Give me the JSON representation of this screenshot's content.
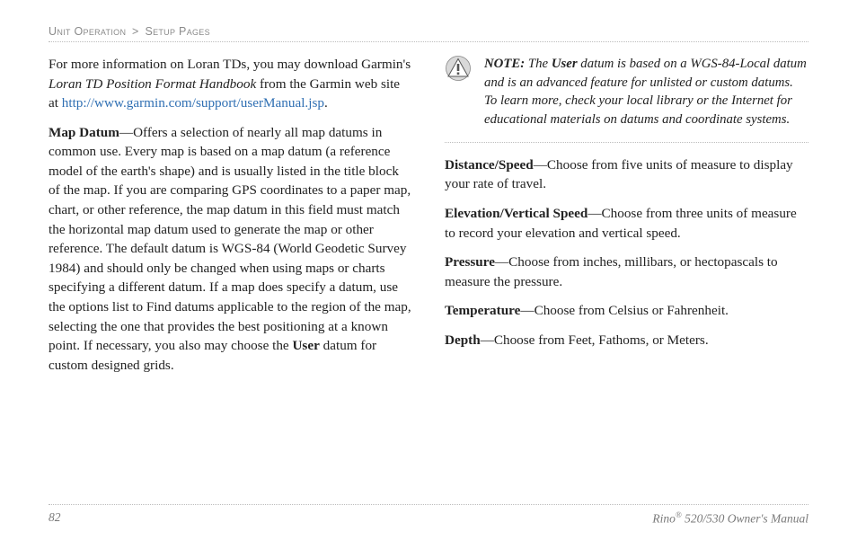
{
  "breadcrumb": {
    "section": "Unit Operation",
    "sep": ">",
    "subsection": "Setup Pages"
  },
  "left": {
    "intro": {
      "pre": "For more information on Loran TDs, you may download Garmin's ",
      "em": "Loran TD Position Format Handbook",
      "mid": " from the Garmin web site at ",
      "link": "http://www.garmin.com/support/userManual.jsp",
      "post": "."
    },
    "mapDatum": {
      "label": "Map Datum",
      "body1": "—Offers a selection of nearly all map datums in common use. Every map is based on a map datum (a reference model of the earth's shape) and is usually listed in the title block of the map. If you are comparing GPS coordinates to a paper map, chart, or other reference, the map datum in this field must match the horizontal map datum used to generate the map or other reference. The default datum is WGS-84 (World Geodetic Survey 1984) and should only be changed when using maps or charts specifying a different datum. If a map does specify a datum, use the options list to Find datums applicable to the region of the map, selecting the one that provides the best positioning at a known point. If necessary, you also may choose the ",
      "userWord": "User",
      "body2": " datum for custom designed grids."
    }
  },
  "right": {
    "note": {
      "label": "NOTE:",
      "pre": " The ",
      "userWord": "User",
      "body": " datum is based on a WGS-84-Local datum and is an advanced feature for unlisted or custom datums. To learn more, check your local library or the Internet for educational materials on datums and coordinate systems."
    },
    "items": {
      "distance": {
        "label": "Distance/Speed",
        "body": "—Choose from five units of measure to display your rate of travel."
      },
      "elevation": {
        "label": "Elevation/Vertical Speed",
        "body": "—Choose from three units of measure to record your elevation and vertical speed."
      },
      "pressure": {
        "label": "Pressure",
        "body": "—Choose from inches, millibars, or hectopascals to measure the pressure."
      },
      "temperature": {
        "label": "Temperature",
        "body": "—Choose from Celsius or Fahrenheit."
      },
      "depth": {
        "label": "Depth",
        "body": "—Choose from Feet, Fathoms, or Meters."
      }
    }
  },
  "footer": {
    "pageNumber": "82",
    "product1": "Rino",
    "reg": "®",
    "product2": " 520/530 Owner's Manual"
  },
  "icons": {
    "warning": "warning-icon"
  }
}
